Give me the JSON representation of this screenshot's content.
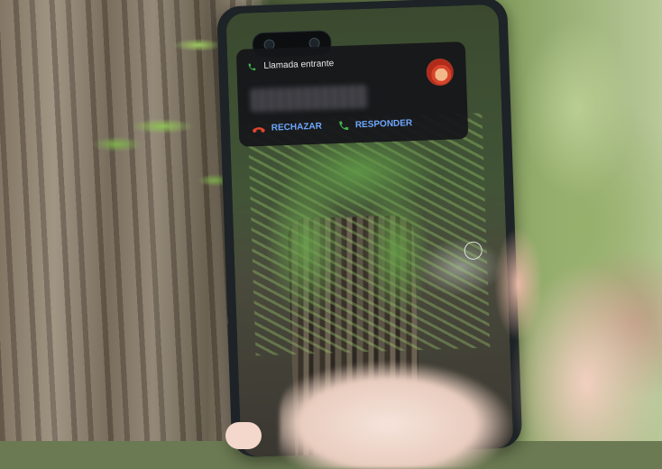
{
  "scene": {
    "description_none": "",
    "colors": {
      "call_card_bg": "#16161a",
      "reject_red": "#e0462f",
      "answer_green": "#3fb24f",
      "action_blue": "#6fa8ff"
    }
  },
  "notification": {
    "title": "Llamada entrante",
    "title_icon": "phone-icon",
    "avatar_icon": "avatar",
    "actions": [
      {
        "label": "RECHAZAR",
        "icon": "phone-hangup-icon"
      },
      {
        "label": "RESPONDER",
        "icon": "phone-answer-icon"
      }
    ]
  }
}
